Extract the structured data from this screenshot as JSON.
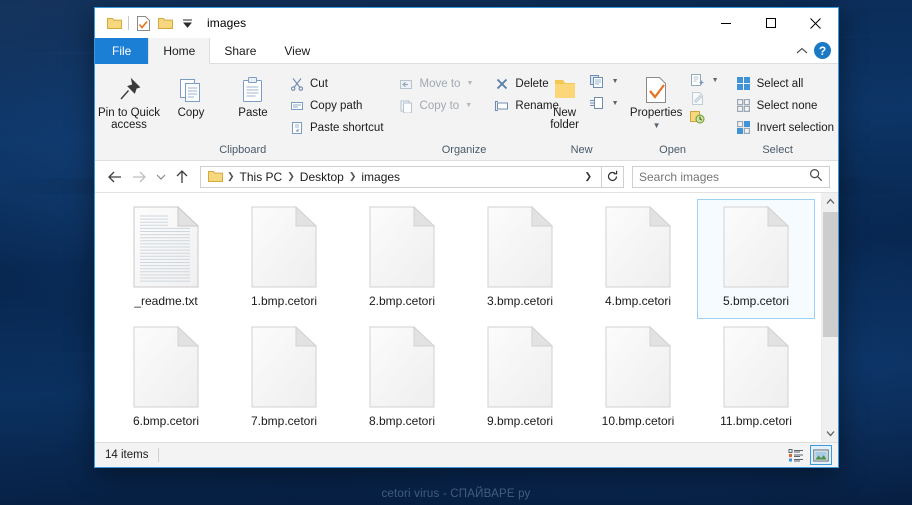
{
  "window": {
    "title": "images",
    "quick_access": [
      {
        "name": "folder-icon"
      },
      {
        "name": "properties-icon"
      },
      {
        "name": "new-folder-icon"
      },
      {
        "name": "customize-dropdown-icon"
      }
    ],
    "caption": {
      "minimize": "minimize-icon",
      "maximize": "maximize-icon",
      "close": "close-icon"
    }
  },
  "ribbon": {
    "tabs": [
      {
        "label": "File",
        "active": false,
        "file": true
      },
      {
        "label": "Home",
        "active": true,
        "file": false
      },
      {
        "label": "Share",
        "active": false,
        "file": false
      },
      {
        "label": "View",
        "active": false,
        "file": false
      }
    ],
    "collapse_label": "^",
    "help_label": "?",
    "groups": [
      {
        "label": "Clipboard",
        "big": [
          {
            "label": "Pin to Quick access",
            "icon": "pin-icon"
          },
          {
            "label": "Copy",
            "icon": "copy-icon"
          },
          {
            "label": "Paste",
            "icon": "paste-icon"
          }
        ],
        "small": [
          {
            "label": "Cut",
            "icon": "scissors-icon",
            "disabled": false,
            "caret": false
          },
          {
            "label": "Copy path",
            "icon": "copy-path-icon",
            "disabled": false,
            "caret": false
          },
          {
            "label": "Paste shortcut",
            "icon": "paste-shortcut-icon",
            "disabled": false,
            "caret": false
          }
        ]
      },
      {
        "label": "Organize",
        "small": [
          {
            "label": "Move to",
            "icon": "move-to-icon",
            "disabled": true,
            "caret": true
          },
          {
            "label": "Copy to",
            "icon": "copy-to-icon",
            "disabled": true,
            "caret": true
          }
        ],
        "small2": [
          {
            "label": "Delete",
            "icon": "delete-icon",
            "disabled": false,
            "caret": true
          },
          {
            "label": "Rename",
            "icon": "rename-icon",
            "disabled": false,
            "caret": false
          }
        ]
      },
      {
        "label": "New",
        "big": [
          {
            "label": "New folder",
            "icon": "new-folder-icon"
          }
        ],
        "small": [
          {
            "label": "",
            "icon": "new-item-icon",
            "disabled": false,
            "caret": true
          },
          {
            "label": "",
            "icon": "easy-access-icon",
            "disabled": false,
            "caret": true
          }
        ]
      },
      {
        "label": "Open",
        "big": [
          {
            "label": "Properties",
            "icon": "properties-icon"
          }
        ],
        "small": [
          {
            "label": "",
            "icon": "open-with-icon",
            "disabled": false,
            "caret": true
          },
          {
            "label": "",
            "icon": "edit-icon",
            "disabled": true,
            "caret": false
          },
          {
            "label": "",
            "icon": "history-icon",
            "disabled": false,
            "caret": false
          }
        ]
      },
      {
        "label": "Select",
        "small": [
          {
            "label": "Select all",
            "icon": "select-all-icon",
            "disabled": false,
            "caret": false
          },
          {
            "label": "Select none",
            "icon": "select-none-icon",
            "disabled": false,
            "caret": false
          },
          {
            "label": "Invert selection",
            "icon": "invert-selection-icon",
            "disabled": false,
            "caret": false
          }
        ]
      }
    ]
  },
  "address": {
    "back_icon": "back-arrow-icon",
    "forward_icon": "forward-arrow-icon",
    "recent_icon": "recent-locations-icon",
    "up_icon": "up-arrow-icon",
    "breadcrumbs": [
      "This PC",
      "Desktop",
      "images"
    ],
    "dropdown_icon": "chevron-down-icon",
    "refresh_icon": "refresh-icon",
    "search_placeholder": "Search images",
    "search_value": "",
    "search_icon": "search-icon"
  },
  "files": [
    {
      "name": "_readme.txt",
      "type": "text",
      "selected": false
    },
    {
      "name": "1.bmp.cetori",
      "type": "blank",
      "selected": false
    },
    {
      "name": "2.bmp.cetori",
      "type": "blank",
      "selected": false
    },
    {
      "name": "3.bmp.cetori",
      "type": "blank",
      "selected": false
    },
    {
      "name": "4.bmp.cetori",
      "type": "blank",
      "selected": false
    },
    {
      "name": "5.bmp.cetori",
      "type": "blank",
      "selected": true
    },
    {
      "name": "6.bmp.cetori",
      "type": "blank",
      "selected": false
    },
    {
      "name": "7.bmp.cetori",
      "type": "blank",
      "selected": false
    },
    {
      "name": "8.bmp.cetori",
      "type": "blank",
      "selected": false
    },
    {
      "name": "9.bmp.cetori",
      "type": "blank",
      "selected": false
    },
    {
      "name": "10.bmp.cetori",
      "type": "blank",
      "selected": false
    },
    {
      "name": "11.bmp.cetori",
      "type": "blank",
      "selected": false
    }
  ],
  "status": {
    "item_count": "14 items",
    "details_view_icon": "details-view-icon",
    "large-icons_view_icon": "large-icons-view-icon",
    "active_view": "large-icons"
  },
  "watermark": {
    "text": "cetori virus - СПАЙВАРЕ ру"
  },
  "colors": {
    "accent": "#1c7fd6",
    "window_border": "#3a9bdc",
    "selection_border": "#9ed0f0",
    "selection_fill": "#f5fbfe",
    "ribbon_bg": "#f3f3f3"
  }
}
